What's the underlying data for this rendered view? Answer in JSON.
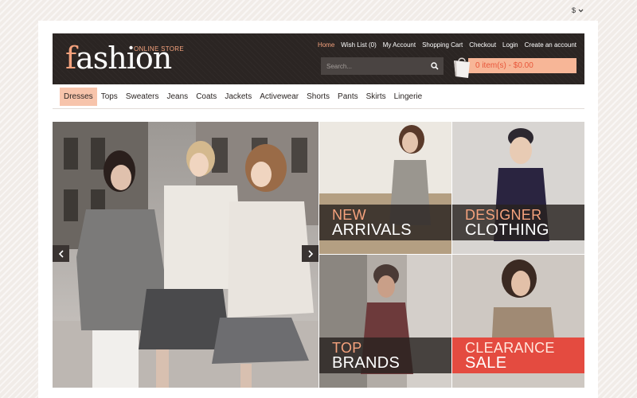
{
  "currency": {
    "symbol": "$"
  },
  "logo": {
    "word_first": "f",
    "word_rest": "ashion",
    "tagline": "ONLINE STORE"
  },
  "toplinks": [
    "Home",
    "Wish List (0)",
    "My Account",
    "Shopping Cart",
    "Checkout",
    "Login",
    "Create an account"
  ],
  "search": {
    "placeholder": "Search..."
  },
  "cart": {
    "summary": "0 item(s) - $0.00"
  },
  "nav": [
    "Dresses",
    "Tops",
    "Sweaters",
    "Jeans",
    "Coats",
    "Jackets",
    "Activewear",
    "Shorts",
    "Pants",
    "Skirts",
    "Lingerie"
  ],
  "banners": [
    {
      "line1": "NEW",
      "line2": "ARRIVALS"
    },
    {
      "line1": "DESIGNER",
      "line2": "CLOTHING"
    },
    {
      "line1": "TOP",
      "line2": "BRANDS"
    },
    {
      "line1": "CLEARANCE",
      "line2": "SALE"
    }
  ],
  "colors": {
    "header_bg": "#2b2523",
    "accent": "#f5a27d",
    "cart_bg": "#f7b697",
    "sale_red": "#e44b40"
  },
  "icons": {
    "search": "search-icon",
    "cart": "shopping-bag-icon",
    "prev": "chevron-left-icon",
    "next": "chevron-right-icon",
    "dropdown": "chevron-down-icon"
  }
}
